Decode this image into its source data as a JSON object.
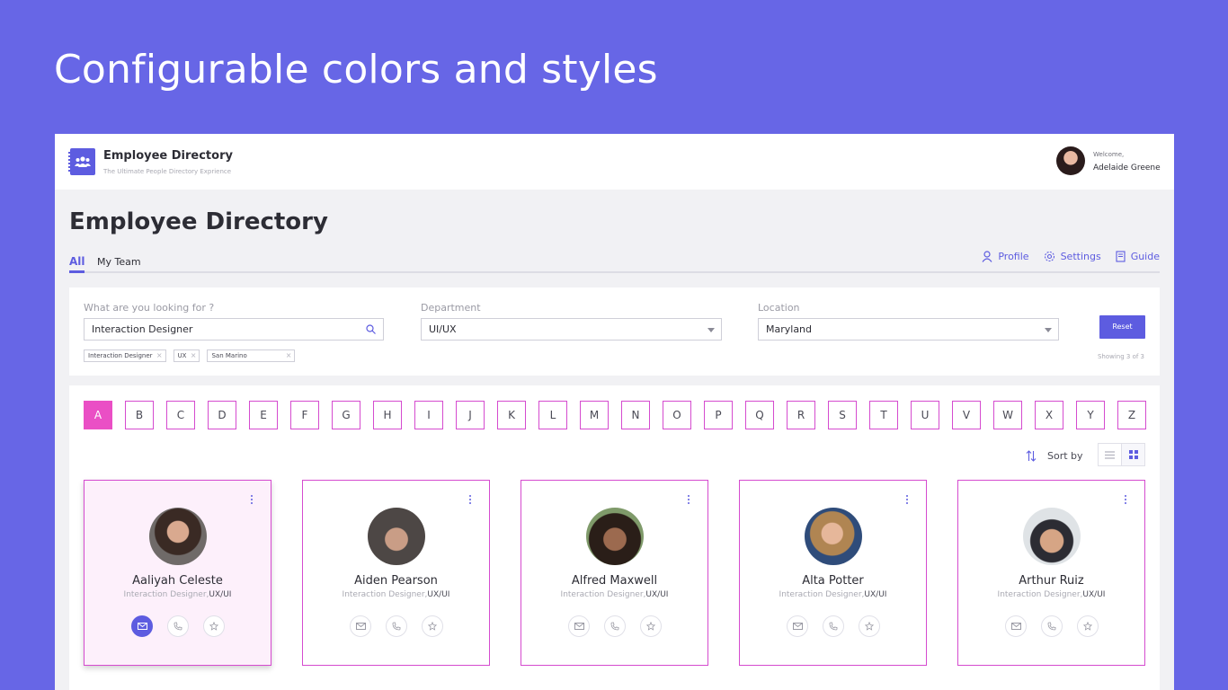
{
  "hero": {
    "title": "Configurable colors and styles"
  },
  "header": {
    "app_title": "Employee Directory",
    "app_subtitle": "The Ultimate People Directory Exprience",
    "welcome": "Welcome,",
    "user_name": "Adelaide Greene"
  },
  "page": {
    "title": "Employee Directory"
  },
  "tabs": [
    {
      "label": "All",
      "active": true
    },
    {
      "label": "My Team",
      "active": false
    }
  ],
  "toplinks": [
    {
      "label": "Profile",
      "icon": "user-icon"
    },
    {
      "label": "Settings",
      "icon": "gear-icon"
    },
    {
      "label": "Guide",
      "icon": "book-icon"
    }
  ],
  "filters": {
    "search_label": "What are you looking for ?",
    "search_value": "Interaction Designer",
    "department_label": "Department",
    "department_value": "UI/UX",
    "location_label": "Location",
    "location_value": "Maryland",
    "chips": [
      "Interaction Designer",
      "UX",
      "San Marino"
    ],
    "reset_label": "Reset",
    "showing": "Showing 3 of 3"
  },
  "letters": [
    "A",
    "B",
    "C",
    "D",
    "E",
    "F",
    "G",
    "H",
    "I",
    "J",
    "K",
    "L",
    "M",
    "N",
    "O",
    "P",
    "Q",
    "R",
    "S",
    "T",
    "U",
    "V",
    "W",
    "X",
    "Y",
    "Z"
  ],
  "active_letter": "A",
  "sort": {
    "label": "Sort by",
    "view": "grid"
  },
  "employees": [
    {
      "name": "Aaliyah Celeste",
      "role": "Interaction Designer,",
      "dept": "UX/UI",
      "selected": true
    },
    {
      "name": "Aiden Pearson",
      "role": "Interaction Designer,",
      "dept": "UX/UI",
      "selected": false
    },
    {
      "name": "Alfred Maxwell",
      "role": "Interaction Designer,",
      "dept": "UX/UI",
      "selected": false
    },
    {
      "name": "Alta Potter",
      "role": "Interaction Designer,",
      "dept": "UX/UI",
      "selected": false
    },
    {
      "name": "Arthur Ruiz",
      "role": "Interaction Designer,",
      "dept": "UX/UI",
      "selected": false
    }
  ],
  "colors": {
    "accent": "#5d5ce0",
    "letter_active": "#ea4fc5",
    "card_border": "#d54bcf",
    "background": "#6766e6"
  }
}
